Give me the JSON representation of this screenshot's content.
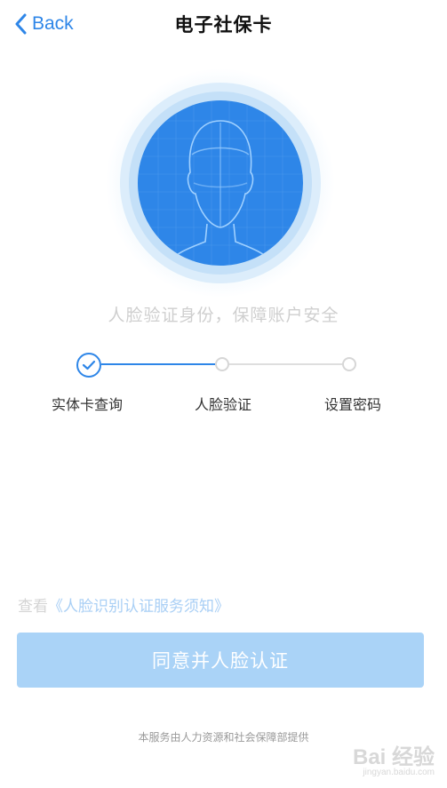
{
  "nav": {
    "back_label": "Back",
    "title": "电子社保卡"
  },
  "face": {
    "icon": "face-scan-icon",
    "outer_ring_color": "#eaf4fd",
    "mid_ring_color": "#c4e0f8",
    "circle_color": "#2e86e8"
  },
  "subtitle": "人脸验证身份，保障账户安全",
  "steps": [
    {
      "label": "实体卡查询",
      "status": "done"
    },
    {
      "label": "人脸验证",
      "status": "pending"
    },
    {
      "label": "设置密码",
      "status": "pending"
    }
  ],
  "notice": {
    "prefix": "查看",
    "link": "《人脸识别认证服务须知》"
  },
  "agree_button": "同意并人脸认证",
  "footer": "本服务由人力资源和社会保障部提供",
  "watermark": {
    "logo": "Bai 经验",
    "url": "jingyan.baidu.com"
  },
  "colors": {
    "accent": "#2e86e8",
    "button_bg": "#aad3f7",
    "link": "#a9cff5"
  }
}
